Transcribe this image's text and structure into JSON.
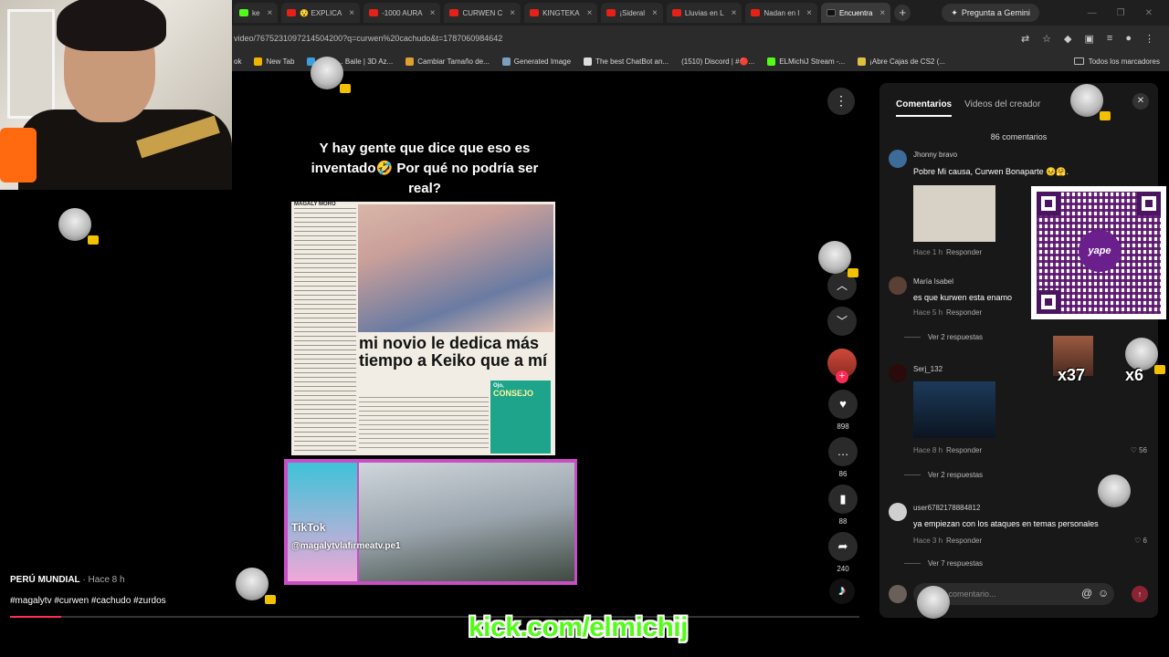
{
  "browser": {
    "tabs": [
      {
        "label": "ke",
        "icon": "kick-icon"
      },
      {
        "label": "😯 EXPLICA",
        "icon": "youtube-icon"
      },
      {
        "label": "-1000 AURA",
        "icon": "youtube-icon"
      },
      {
        "label": "CURWEN C",
        "icon": "youtube-icon"
      },
      {
        "label": "KINGTEKA",
        "icon": "youtube-icon"
      },
      {
        "label": "¡Sideral",
        "icon": "youtube-icon"
      },
      {
        "label": "Lluvias en L",
        "icon": "youtube-icon"
      },
      {
        "label": "Nadan en l",
        "icon": "youtube-icon"
      },
      {
        "label": "Encuentra",
        "icon": "tiktok-icon",
        "active": true
      }
    ],
    "gemini_label": "Pregunta a Gemini",
    "url": "video/7675231097214504200?q=curwen%20cachudo&t=1787060984642",
    "bookmarks": [
      "ok",
      "New Tab",
      "1 sub... Baile | 3D Az...",
      "Cambiar Tamaño de...",
      "Generated Image",
      "The best ChatBot an...",
      "(1510) Discord | #🔴...",
      "ELMichiJ Stream -...",
      "¡Abre Cajas de CS2 (..."
    ],
    "bookmarks_folder": "Todos los marcadores"
  },
  "video": {
    "caption": "Y hay gente que dice que eso es inventado🤣 Por qué no podría ser real?",
    "magazine": {
      "header": "MAGALY MORO",
      "headline": "mi novio le dedica más tiempo a Keiko que a mí",
      "box_title": "CONSEJO",
      "box_label": "Ojo,"
    },
    "clip": {
      "watermark": "TikTok",
      "handle": "@magalytvlafirmeatv.pe1"
    },
    "author": "PERÚ MUNDIAL",
    "time": "· Hace 8 h",
    "tags": "#magalytv #curwen #cachudo #zurdos",
    "progress": 0.06,
    "actions": {
      "likes": "898",
      "comments": "86",
      "saves": "88",
      "shares": "240"
    }
  },
  "comments_panel": {
    "tabs": [
      "Comentarios",
      "Videos del creador"
    ],
    "count": "86 comentarios",
    "comments": [
      {
        "user": "Jhonny bravo",
        "text": "Pobre Mi causa, Curwen Bonaparte 😣🤗.",
        "time": "Hace 1 h",
        "reply": "Responder",
        "likes": ""
      },
      {
        "user": "María Isabel",
        "text": "es que kurwen esta enamo",
        "time": "Hace 5 h",
        "reply": "Responder",
        "likes": "",
        "replies": "Ver 2 respuestas"
      },
      {
        "user": "Serj_132",
        "text": "",
        "time": "Hace 8 h",
        "reply": "Responder",
        "likes": "56",
        "replies": "Ver 2 respuestas"
      },
      {
        "user": "user6782178884812",
        "text": "ya empiezan con los ataques en temas personales",
        "time": "Hace 3 h",
        "reply": "Responder",
        "likes": "6",
        "replies": "Ver 7 respuestas"
      }
    ],
    "input_placeholder": "Añadir comentario..."
  },
  "overlays": {
    "qr_brand": "yape",
    "multiplier_1": "x37",
    "multiplier_2": "x6",
    "kick_banner": "kick.com/elmichij"
  }
}
